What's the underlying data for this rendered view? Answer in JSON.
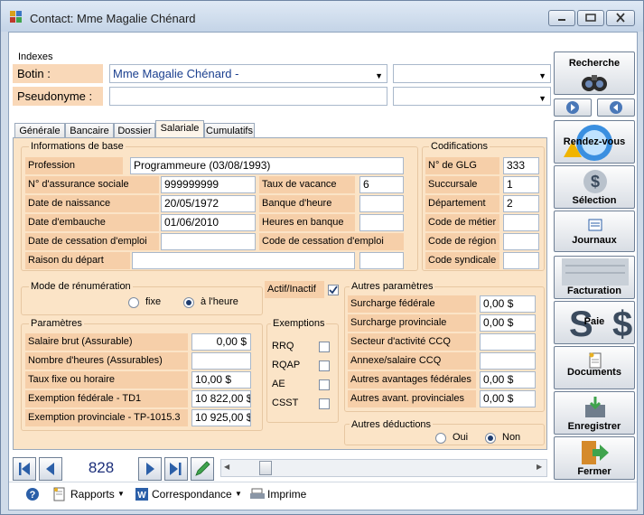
{
  "window": {
    "title": "Contact: Mme Magalie Chénard"
  },
  "indexes": {
    "title": "Indexes",
    "botin_label": "Botin :",
    "botin_value": "Mme Magalie Chénard  -",
    "pseudonyme_label": "Pseudonyme :"
  },
  "tabs": [
    {
      "label": "Générale"
    },
    {
      "label": "Bancaire"
    },
    {
      "label": "Dossier"
    },
    {
      "label": "Salariale"
    },
    {
      "label": "Cumulatifs"
    }
  ],
  "info_base": {
    "title": "Informations de base",
    "profession_label": "Profession",
    "profession_value": "Programmeure (03/08/1993)",
    "nas_label": "N° d'assurance sociale",
    "nas_value": "999999999",
    "taux_vacance_label": "Taux de vacance",
    "taux_vacance_value": "6",
    "naissance_label": "Date de naissance",
    "naissance_value": "20/05/1972",
    "banque_heure_label": "Banque d'heure",
    "embauche_label": "Date d'embauche",
    "embauche_value": "01/06/2010",
    "heures_banque_label": "Heures en banque",
    "cessation_label": "Date de cessation d'emploi",
    "code_cessation_label": "Code de cessation d'emploi",
    "raison_label": "Raison du départ"
  },
  "codifications": {
    "title": "Codifications",
    "glg_label": "N° de GLG",
    "glg_value": "333",
    "succursale_label": "Succursale",
    "succursale_value": "1",
    "departement_label": "Département",
    "departement_value": "2",
    "metier_label": "Code de métier",
    "region_label": "Code de région",
    "syndicale_label": "Code syndicale"
  },
  "remuneration": {
    "title": "Mode de rénumération",
    "fixe_label": "fixe",
    "heure_label": "à l'heure",
    "selected": "heure"
  },
  "actif": {
    "label": "Actif/Inactif",
    "checked": true
  },
  "parametres": {
    "title": "Paramètres",
    "salaire_label": "Salaire brut (Assurable)",
    "salaire_value": "0,00 $",
    "heures_label": "Nombre d'heures (Assurables)",
    "taux_label": "Taux fixe ou horaire",
    "taux_value": "10,00 $",
    "exempt_fed_label": "Exemption fédérale - TD1",
    "exempt_fed_value": "10 822,00 $",
    "exempt_prov_label": "Exemption provinciale - TP-1015.3",
    "exempt_prov_value": "10 925,00 $"
  },
  "exemptions": {
    "title": "Exemptions",
    "items": [
      {
        "label": "RRQ"
      },
      {
        "label": "RQAP"
      },
      {
        "label": "AE"
      },
      {
        "label": "CSST"
      }
    ]
  },
  "autres_param": {
    "title": "Autres paramètres",
    "surcharge_fed_label": "Surcharge fédérale",
    "surcharge_fed_value": "0,00 $",
    "surcharge_prov_label": "Surcharge provinciale",
    "surcharge_prov_value": "0,00 $",
    "secteur_label": "Secteur d'activité CCQ",
    "annexe_label": "Annexe/salaire CCQ",
    "avantages_fed_label": "Autres avantages fédérales",
    "avantages_fed_value": "0,00 $",
    "avant_prov_label": "Autres avant. provinciales",
    "avant_prov_value": "0,00 $"
  },
  "autres_deductions": {
    "title": "Autres déductions",
    "oui_label": "Oui",
    "non_label": "Non",
    "selected": "non"
  },
  "navigation": {
    "record": "828"
  },
  "right_buttons": {
    "recherche": "Recherche",
    "rendezvous": "Rendez-vous",
    "selection": "Sélection",
    "journaux": "Journaux",
    "facturation": "Facturation",
    "paie": "Paie",
    "documents": "Documents",
    "enregistrer": "Enregistrer",
    "fermer": "Fermer"
  },
  "statusbar": {
    "rapports": "Rapports",
    "correspondance": "Correspondance",
    "imprime": "Imprime"
  },
  "colors": {
    "label_bg": "#f6cfa9",
    "panel_bg": "#fbe4c7",
    "accent": "#2b5fa8"
  }
}
